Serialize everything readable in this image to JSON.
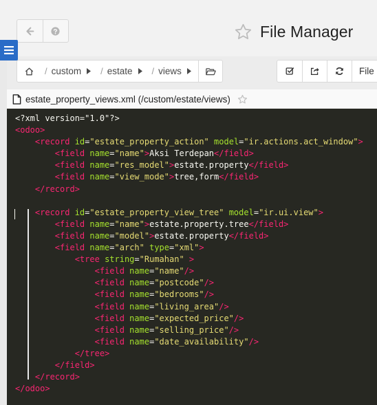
{
  "header": {
    "title": "File Manager",
    "icons": {
      "back": "arrow-left-icon",
      "help": "question-circle-icon",
      "favorite": "star-outline-icon",
      "menu": "hamburger-icon"
    }
  },
  "breadcrumb": {
    "items": [
      "custom",
      "estate",
      "views"
    ],
    "icons": {
      "home": "home-icon",
      "separator": "slash",
      "expand": "caret-right-icon",
      "open_folder": "folder-open-icon"
    }
  },
  "toolbar": {
    "file_label": "File",
    "icons": [
      "check-square-icon",
      "share-square-icon",
      "refresh-icon"
    ]
  },
  "file": {
    "label": "estate_property_views.xml (/custom/estate/views)",
    "icon": "file-icon",
    "favorite_icon": "star-outline-icon"
  },
  "editor": {
    "theme": {
      "background": "#272822",
      "tag": "#f92672",
      "attr": "#a6e22e",
      "string": "#e6db74",
      "text": "#f8f8f2"
    },
    "lines": [
      [
        [
          "pi",
          "<?xml version=\"1.0\"?>"
        ]
      ],
      [
        [
          "tag",
          "<odoo>"
        ]
      ],
      [
        [
          "txt",
          "    "
        ],
        [
          "tag",
          "<record "
        ],
        [
          "attr",
          "id"
        ],
        [
          "txt",
          "="
        ],
        [
          "str",
          "\"estate_property_action\""
        ],
        [
          "txt",
          " "
        ],
        [
          "attr",
          "model"
        ],
        [
          "txt",
          "="
        ],
        [
          "str",
          "\"ir.actions.act_window\""
        ],
        [
          "tag",
          ">"
        ]
      ],
      [
        [
          "txt",
          "        "
        ],
        [
          "tag",
          "<field "
        ],
        [
          "attr",
          "name"
        ],
        [
          "txt",
          "="
        ],
        [
          "str",
          "\"name\""
        ],
        [
          "tag",
          ">"
        ],
        [
          "txt",
          "Aksi Terdepan"
        ],
        [
          "tag",
          "</field>"
        ]
      ],
      [
        [
          "txt",
          "        "
        ],
        [
          "tag",
          "<field "
        ],
        [
          "attr",
          "name"
        ],
        [
          "txt",
          "="
        ],
        [
          "str",
          "\"res_model\""
        ],
        [
          "tag",
          ">"
        ],
        [
          "txt",
          "estate.property"
        ],
        [
          "tag",
          "</field>"
        ]
      ],
      [
        [
          "txt",
          "        "
        ],
        [
          "tag",
          "<field "
        ],
        [
          "attr",
          "name"
        ],
        [
          "txt",
          "="
        ],
        [
          "str",
          "\"view_mode\""
        ],
        [
          "tag",
          ">"
        ],
        [
          "txt",
          "tree,form"
        ],
        [
          "tag",
          "</field>"
        ]
      ],
      [
        [
          "txt",
          "    "
        ],
        [
          "tag",
          "</record>"
        ]
      ],
      [
        [
          "txt",
          ""
        ]
      ],
      [
        [
          "txt",
          "    "
        ],
        [
          "tag",
          "<record "
        ],
        [
          "attr",
          "id"
        ],
        [
          "txt",
          "="
        ],
        [
          "str",
          "\"estate_property_view_tree\""
        ],
        [
          "txt",
          " "
        ],
        [
          "attr",
          "model"
        ],
        [
          "txt",
          "="
        ],
        [
          "str",
          "\"ir.ui.view\""
        ],
        [
          "tag",
          ">"
        ]
      ],
      [
        [
          "txt",
          "        "
        ],
        [
          "tag",
          "<field "
        ],
        [
          "attr",
          "name"
        ],
        [
          "txt",
          "="
        ],
        [
          "str",
          "\"name\""
        ],
        [
          "tag",
          ">"
        ],
        [
          "txt",
          "estate.property.tree"
        ],
        [
          "tag",
          "</field>"
        ]
      ],
      [
        [
          "txt",
          "        "
        ],
        [
          "tag",
          "<field "
        ],
        [
          "attr",
          "name"
        ],
        [
          "txt",
          "="
        ],
        [
          "str",
          "\"model\""
        ],
        [
          "tag",
          ">"
        ],
        [
          "txt",
          "estate.property"
        ],
        [
          "tag",
          "</field>"
        ]
      ],
      [
        [
          "txt",
          "        "
        ],
        [
          "tag",
          "<field "
        ],
        [
          "attr",
          "name"
        ],
        [
          "txt",
          "="
        ],
        [
          "str",
          "\"arch\""
        ],
        [
          "txt",
          " "
        ],
        [
          "attr",
          "type"
        ],
        [
          "txt",
          "="
        ],
        [
          "str",
          "\"xml\""
        ],
        [
          "tag",
          ">"
        ]
      ],
      [
        [
          "txt",
          "            "
        ],
        [
          "tag",
          "<tree "
        ],
        [
          "attr",
          "string"
        ],
        [
          "txt",
          "="
        ],
        [
          "str",
          "\"Rumahan\""
        ],
        [
          "txt",
          " "
        ],
        [
          "tag",
          ">"
        ]
      ],
      [
        [
          "txt",
          "                "
        ],
        [
          "tag",
          "<field "
        ],
        [
          "attr",
          "name"
        ],
        [
          "txt",
          "="
        ],
        [
          "str",
          "\"name\""
        ],
        [
          "tag",
          "/>"
        ]
      ],
      [
        [
          "txt",
          "                "
        ],
        [
          "tag",
          "<field "
        ],
        [
          "attr",
          "name"
        ],
        [
          "txt",
          "="
        ],
        [
          "str",
          "\"postcode\""
        ],
        [
          "tag",
          "/>"
        ]
      ],
      [
        [
          "txt",
          "                "
        ],
        [
          "tag",
          "<field "
        ],
        [
          "attr",
          "name"
        ],
        [
          "txt",
          "="
        ],
        [
          "str",
          "\"bedrooms\""
        ],
        [
          "tag",
          "/>"
        ]
      ],
      [
        [
          "txt",
          "                "
        ],
        [
          "tag",
          "<field "
        ],
        [
          "attr",
          "name"
        ],
        [
          "txt",
          "="
        ],
        [
          "str",
          "\"living_area\""
        ],
        [
          "tag",
          "/>"
        ]
      ],
      [
        [
          "txt",
          "                "
        ],
        [
          "tag",
          "<field "
        ],
        [
          "attr",
          "name"
        ],
        [
          "txt",
          "="
        ],
        [
          "str",
          "\"expected_price\""
        ],
        [
          "tag",
          "/>"
        ]
      ],
      [
        [
          "txt",
          "                "
        ],
        [
          "tag",
          "<field "
        ],
        [
          "attr",
          "name"
        ],
        [
          "txt",
          "="
        ],
        [
          "str",
          "\"selling_price\""
        ],
        [
          "tag",
          "/>"
        ]
      ],
      [
        [
          "txt",
          "                "
        ],
        [
          "tag",
          "<field "
        ],
        [
          "attr",
          "name"
        ],
        [
          "txt",
          "="
        ],
        [
          "str",
          "\"date_availability\""
        ],
        [
          "tag",
          "/>"
        ]
      ],
      [
        [
          "txt",
          "            "
        ],
        [
          "tag",
          "</tree>"
        ]
      ],
      [
        [
          "txt",
          "        "
        ],
        [
          "tag",
          "</field>"
        ]
      ],
      [
        [
          "txt",
          "    "
        ],
        [
          "tag",
          "</record>"
        ]
      ],
      [
        [
          "tag",
          "</odoo>"
        ]
      ]
    ]
  }
}
